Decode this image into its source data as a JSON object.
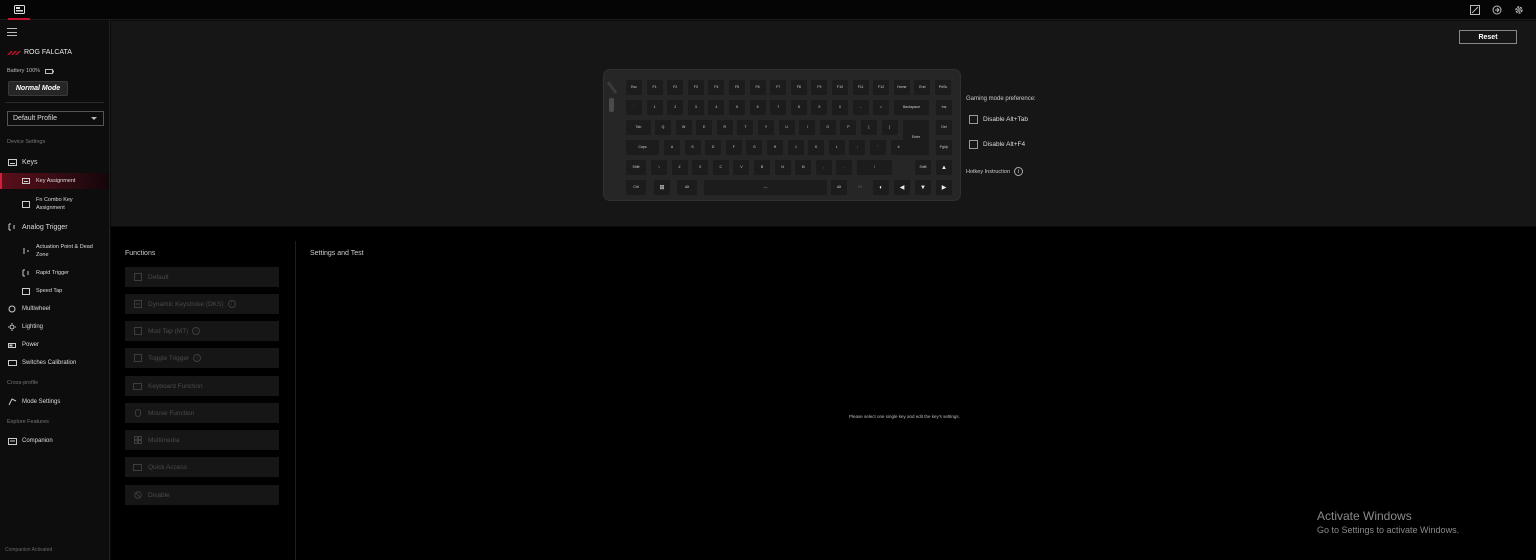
{
  "sidebar": {
    "device_name": "ROG FALCATA",
    "battery": "Battery 100%",
    "mode": "Normal Mode",
    "profile": "Default Profile",
    "section_device": "Device Settings",
    "keys": "Keys",
    "key_assignment": "Key Assignment",
    "fn_combo": "Fn Combo Key Assignment",
    "analog_trigger": "Analog Trigger",
    "actuation": "Actuation Point & Dead Zone",
    "rapid_trigger": "Rapid Trigger",
    "speed_tap": "Speed Tap",
    "multiwheel": "Multiwheel",
    "lighting": "Lighting",
    "power": "Power",
    "switches": "Switches Calibration",
    "section_cross": "Cross-profile",
    "mode_settings": "Mode Settings",
    "section_explore": "Explore Features",
    "companion": "Companion",
    "companion_status": "Companion Activated"
  },
  "keyboard": {
    "reset": "Reset",
    "rows": [
      [
        "Esc",
        "F1",
        "F2",
        "F3",
        "F4",
        "F5",
        "F6",
        "F7",
        "F8",
        "F9",
        "F10",
        "F11",
        "F12",
        "Home",
        "End",
        "PrtSc"
      ],
      [
        "`",
        "1",
        "2",
        "3",
        "4",
        "5",
        "6",
        "7",
        "8",
        "9",
        "0",
        "-",
        "=",
        "Backspace",
        "Ins"
      ],
      [
        "Tab",
        "Q",
        "W",
        "E",
        "R",
        "T",
        "Y",
        "U",
        "I",
        "O",
        "P",
        "[",
        "]",
        "Enter",
        "Del"
      ],
      [
        "Caps",
        "A",
        "S",
        "D",
        "F",
        "G",
        "H",
        "J",
        "K",
        "L",
        ";",
        "'",
        "#",
        "PgUp"
      ],
      [
        "Shift",
        "\\",
        "Z",
        "X",
        "C",
        "V",
        "B",
        "N",
        "M",
        ",",
        ".",
        "/",
        "Shift",
        "▲",
        "PgDn"
      ],
      [
        "Ctrl",
        "⊞",
        "Alt",
        "—",
        "Alt",
        "Fn",
        "◐",
        "◀",
        "▼",
        "▶"
      ]
    ],
    "gaming_label": "Gaming mode preference:",
    "opt_alt_tab": "Disable Alt+Tab",
    "opt_alt_f4": "Disable Alt+F4",
    "hotkey": "Hotkey Instruction"
  },
  "functions": {
    "title": "Functions",
    "items": [
      "Default",
      "Dynamic Keystroke (DKS)",
      "Mod Tap (MT)",
      "Toggle Trigger",
      "Keyboard Function",
      "Mouse Function",
      "Multimedia",
      "Quick Access",
      "Disable"
    ]
  },
  "settings": {
    "title": "Settings and Test",
    "hint": "Please select one single key and edit the key's settings."
  },
  "watermark": {
    "line1": "Activate Windows",
    "line2": "Go to Settings to activate Windows."
  }
}
